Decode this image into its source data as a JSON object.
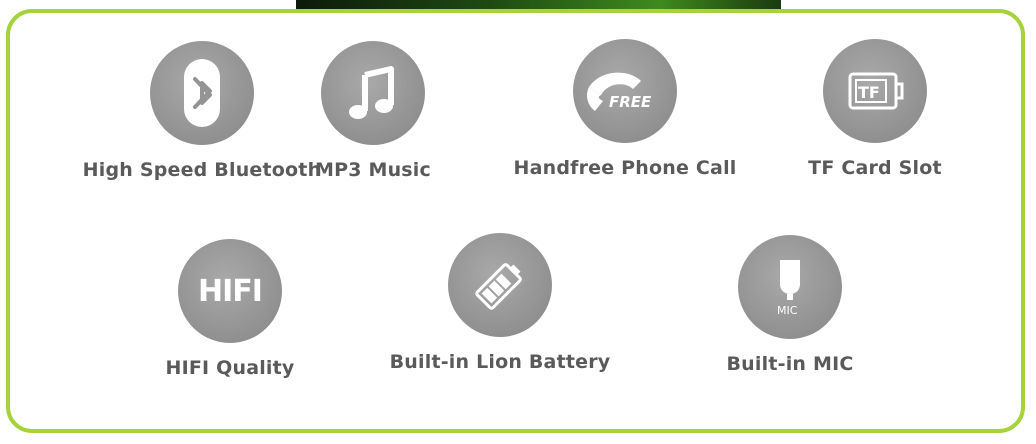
{
  "features_row1": [
    {
      "label": "High Speed Bluetooth",
      "icon": "bluetooth-icon"
    },
    {
      "label": "MP3 Music",
      "icon": "music-note-icon"
    },
    {
      "label": "Handfree Phone Call",
      "icon": "handfree-phone-icon",
      "icon_text": "FREE"
    },
    {
      "label": "TF Card Slot",
      "icon": "tf-card-icon",
      "icon_text": "TF"
    }
  ],
  "features_row2": [
    {
      "label": "HIFI Quality",
      "icon": "hifi-icon",
      "icon_text": "HIFI"
    },
    {
      "label": "Built-in Lion Battery",
      "icon": "battery-icon"
    },
    {
      "label": "Built-in MIC",
      "icon": "microphone-icon",
      "icon_text": "MIC"
    }
  ],
  "colors": {
    "frame_border": "#a6d23c",
    "icon_circle": "#949494",
    "label_text": "#5a5a5a"
  }
}
